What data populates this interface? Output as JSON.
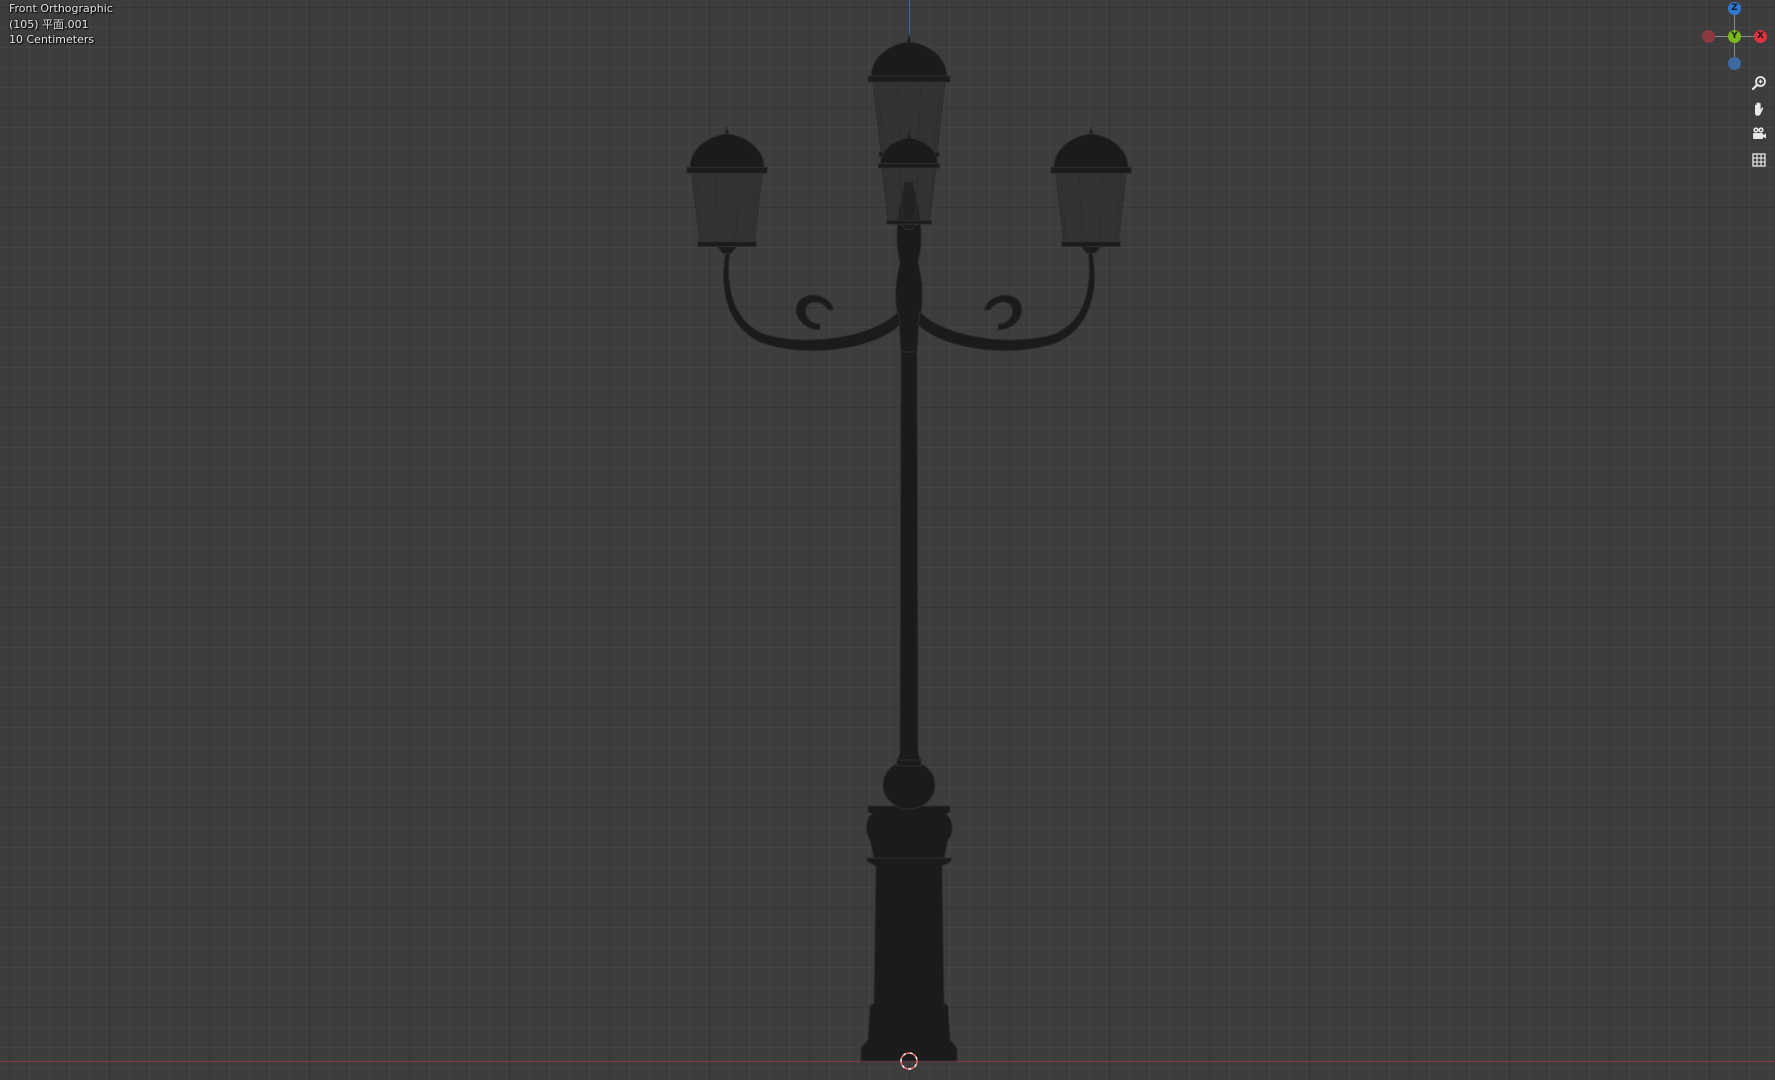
{
  "viewport": {
    "view_name": "Front Orthographic",
    "object_info": "(105) 平面.001",
    "grid_scale": "10 Centimeters"
  },
  "gizmo": {
    "z_label": "Z",
    "y_label": "Y",
    "x_label": "X",
    "colors": {
      "z": "#2f78d6",
      "y": "#7ab81c",
      "x": "#e0323f",
      "neg_x": "#8c3a42",
      "neg_z": "#3d6aa0"
    }
  },
  "tools": [
    {
      "icon": "zoom-icon"
    },
    {
      "icon": "hand-pan-icon"
    },
    {
      "icon": "camera-view-icon"
    },
    {
      "icon": "grid-perspective-icon"
    }
  ],
  "colors": {
    "background": "#3d3d3d",
    "lamp_fill": "#1b1b1b",
    "lamp_wire": "#2c2c2c",
    "x_axis_line": "#8c3a42",
    "z_axis_line": "#2f6fb0",
    "cursor": "#ff6b6b"
  }
}
